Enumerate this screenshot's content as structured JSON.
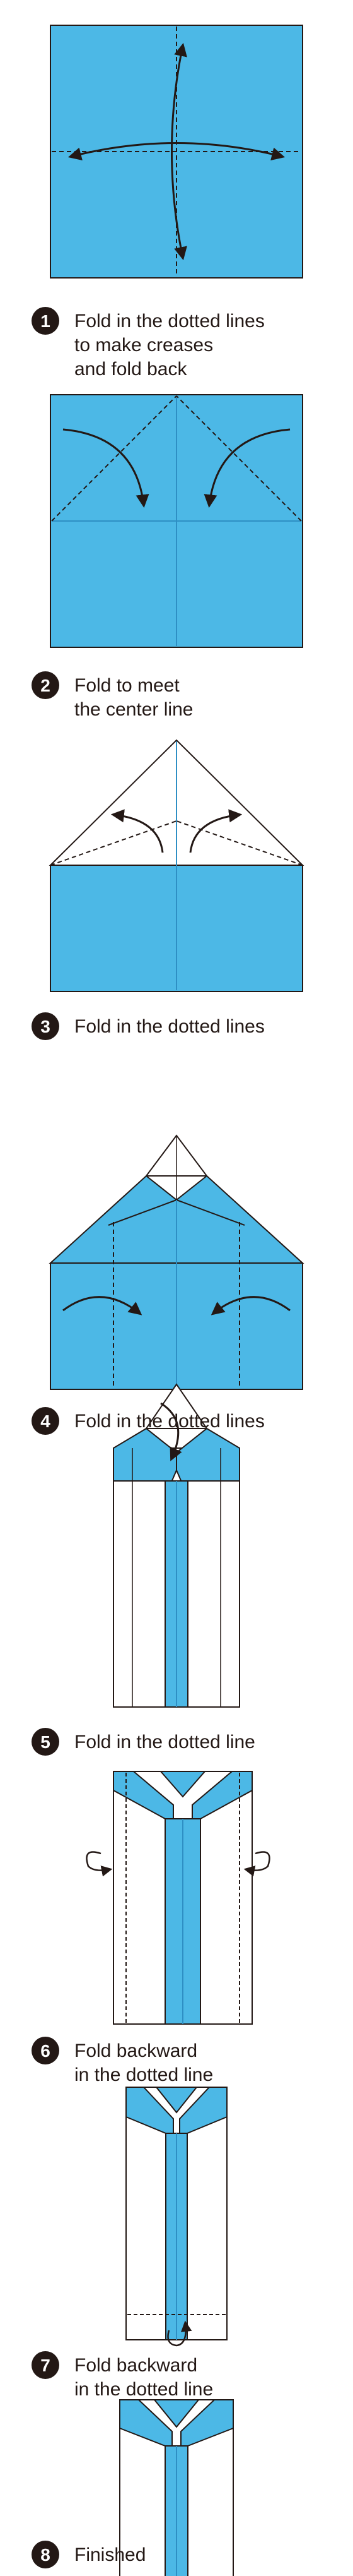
{
  "colors": {
    "paper_blue": "#4CB8E6",
    "paper_white": "#FFFFFF",
    "line": "#231815",
    "crease": "#2E8FC4",
    "number_badge": "#231815"
  },
  "steps": [
    {
      "number": "1",
      "lines": [
        "Fold in the dotted lines",
        "to make creases",
        "and fold back"
      ]
    },
    {
      "number": "2",
      "lines": [
        "Fold to meet",
        "the center line"
      ]
    },
    {
      "number": "3",
      "lines": [
        "Fold in the dotted lines"
      ]
    },
    {
      "number": "4",
      "lines": [
        "Fold in the dotted lines"
      ]
    },
    {
      "number": "5",
      "lines": [
        "Fold in the dotted line"
      ]
    },
    {
      "number": "6",
      "lines": [
        "Fold backward",
        "in the dotted line"
      ]
    },
    {
      "number": "7",
      "lines": [
        "Fold backward",
        "in the dotted line"
      ]
    },
    {
      "number": "8",
      "lines": [
        "Finished"
      ]
    }
  ]
}
